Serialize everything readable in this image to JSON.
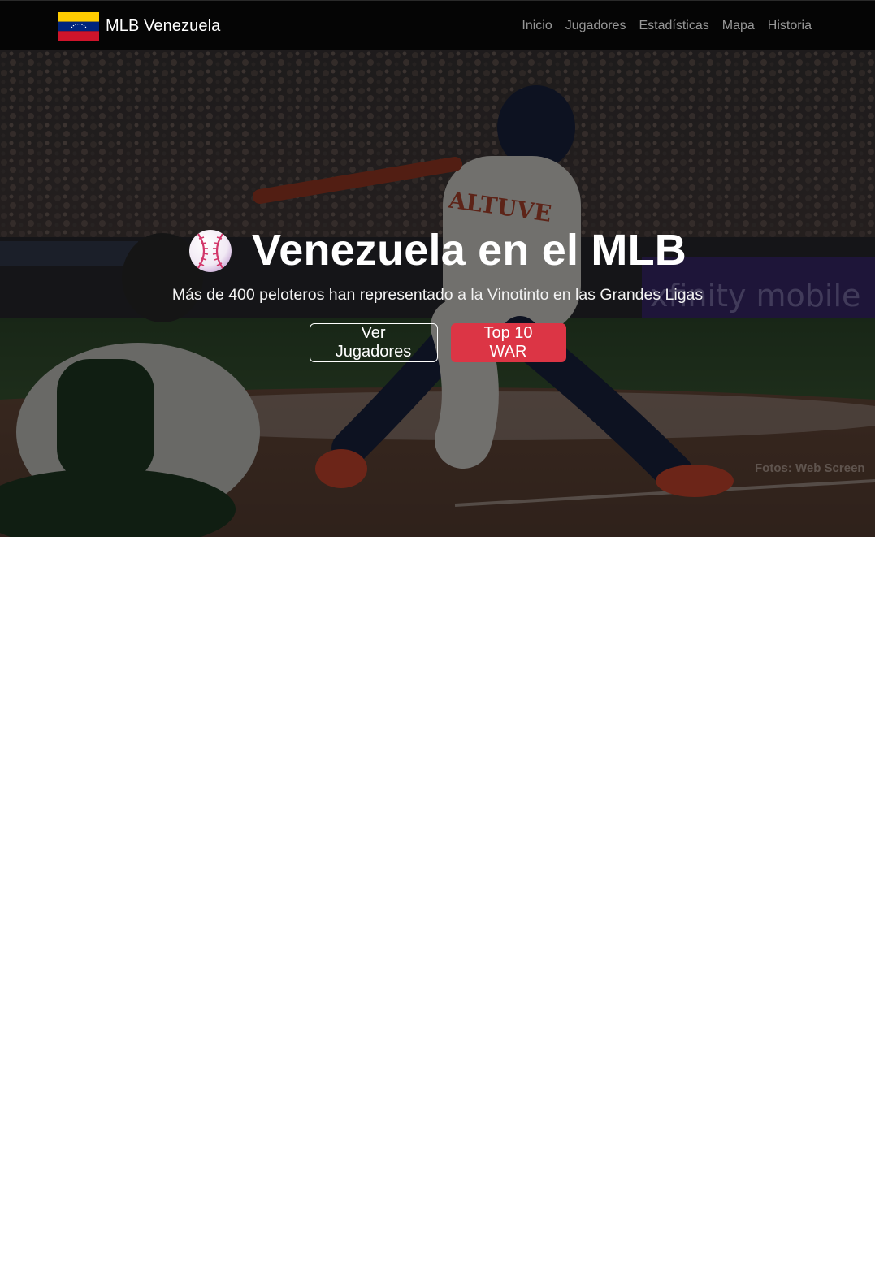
{
  "navbar": {
    "brand": "MLB Venezuela",
    "links": [
      "Inicio",
      "Jugadores",
      "Estadísticas",
      "Mapa",
      "Historia"
    ]
  },
  "hero": {
    "title": "Venezuela en el MLB",
    "subtitle": "Más de 400 peloteros han representado a la Vinotinto en las Grandes Ligas",
    "buttons": {
      "primary": "Ver Jugadores",
      "secondary": "Top 10 WAR"
    },
    "photo_credit": "Fotos: Web Screen",
    "background_image": "baseball-batter-photo"
  },
  "icons": {
    "flag": "venezuela-flag-icon",
    "title_icon": "baseball-icon"
  },
  "colors": {
    "navbar_bg": "#050505",
    "accent_red": "#dc3545",
    "flag_yellow": "#ffcc00",
    "flag_blue": "#00247d",
    "flag_red": "#cf142b"
  }
}
